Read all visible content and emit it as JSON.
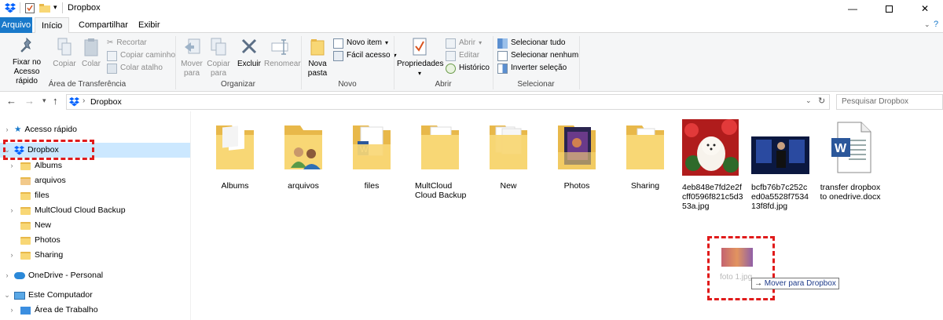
{
  "window": {
    "title": "Dropbox",
    "min_icon": "minimize-icon",
    "max_icon": "maximize-icon",
    "close_icon": "close-icon"
  },
  "tabs": [
    "Arquivo",
    "Início",
    "Compartilhar",
    "Exibir"
  ],
  "ribbon": {
    "clipboard": {
      "label": "Área de Transferência",
      "pin": "Fixar no Acesso rápido",
      "copy": "Copiar",
      "paste": "Colar",
      "cut": "Recortar",
      "copy_path": "Copiar caminho",
      "paste_shortcut": "Colar atalho"
    },
    "organize": {
      "label": "Organizar",
      "move": "Mover para",
      "copy_to": "Copiar para",
      "delete": "Excluir",
      "rename": "Renomear"
    },
    "new": {
      "label": "Novo",
      "new_folder": "Nova pasta",
      "new_item": "Novo item",
      "easy_access": "Fácil acesso"
    },
    "open": {
      "label": "Abrir",
      "properties": "Propriedades",
      "open": "Abrir",
      "edit": "Editar",
      "history": "Histórico"
    },
    "select": {
      "label": "Selecionar",
      "select_all": "Selecionar tudo",
      "select_none": "Selecionar nenhum",
      "invert": "Inverter seleção"
    }
  },
  "address": {
    "path": "Dropbox",
    "search_placeholder": "Pesquisar Dropbox"
  },
  "nav": [
    {
      "label": "Acesso rápido"
    },
    {
      "label": "Dropbox"
    },
    {
      "label": "Albums"
    },
    {
      "label": "arquivos"
    },
    {
      "label": "files"
    },
    {
      "label": "MultCloud Cloud Backup"
    },
    {
      "label": "New"
    },
    {
      "label": "Photos"
    },
    {
      "label": "Sharing"
    },
    {
      "label": "OneDrive - Personal"
    },
    {
      "label": "Este Computador"
    },
    {
      "label": "Área de Trabalho"
    }
  ],
  "files": [
    {
      "name": "Albums"
    },
    {
      "name": "arquivos"
    },
    {
      "name": "files"
    },
    {
      "name": "MultCloud Cloud Backup"
    },
    {
      "name": "New"
    },
    {
      "name": "Photos"
    },
    {
      "name": "Sharing"
    },
    {
      "name": "4eb848e7fd2e2fcff0596f821c5d353a.jpg"
    },
    {
      "name": "bcfb76b7c252ced0a5528f753413f8fd.jpg"
    },
    {
      "name": "transfer dropbox to onedrive.docx"
    }
  ],
  "drag": {
    "file_name": "foto 1.jpg",
    "tooltip": "Mover para Dropbox"
  },
  "colors": {
    "accent": "#1979ca",
    "highlight": "#cce8ff",
    "annotation": "#e01b1b",
    "folder": "#f8d775"
  }
}
